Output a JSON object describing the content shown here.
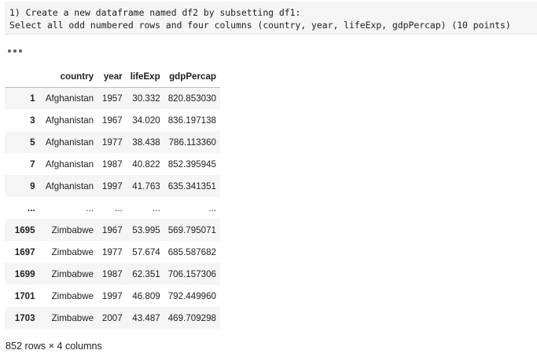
{
  "code_cell": {
    "line1": "1) Create a new dataframe named df2 by subsetting df1:",
    "line2": "Select all odd numbered rows and four columns (country, year, lifeExp, gdpPercap) (10 points)"
  },
  "output": {
    "columns": [
      "",
      "country",
      "year",
      "lifeExp",
      "gdpPercap"
    ],
    "rows": [
      {
        "index": "1",
        "country": "Afghanistan",
        "year": "1957",
        "lifeExp": "30.332",
        "gdpPercap": "820.853030"
      },
      {
        "index": "3",
        "country": "Afghanistan",
        "year": "1967",
        "lifeExp": "34.020",
        "gdpPercap": "836.197138"
      },
      {
        "index": "5",
        "country": "Afghanistan",
        "year": "1977",
        "lifeExp": "38.438",
        "gdpPercap": "786.113360"
      },
      {
        "index": "7",
        "country": "Afghanistan",
        "year": "1987",
        "lifeExp": "40.822",
        "gdpPercap": "852.395945"
      },
      {
        "index": "9",
        "country": "Afghanistan",
        "year": "1997",
        "lifeExp": "41.763",
        "gdpPercap": "635.341351"
      },
      {
        "index": "...",
        "country": "...",
        "year": "...",
        "lifeExp": "...",
        "gdpPercap": "..."
      },
      {
        "index": "1695",
        "country": "Zimbabwe",
        "year": "1967",
        "lifeExp": "53.995",
        "gdpPercap": "569.795071"
      },
      {
        "index": "1697",
        "country": "Zimbabwe",
        "year": "1977",
        "lifeExp": "57.674",
        "gdpPercap": "685.587682"
      },
      {
        "index": "1699",
        "country": "Zimbabwe",
        "year": "1987",
        "lifeExp": "62.351",
        "gdpPercap": "706.157306"
      },
      {
        "index": "1701",
        "country": "Zimbabwe",
        "year": "1997",
        "lifeExp": "46.809",
        "gdpPercap": "792.449960"
      },
      {
        "index": "1703",
        "country": "Zimbabwe",
        "year": "2007",
        "lifeExp": "43.487",
        "gdpPercap": "469.709298"
      }
    ],
    "shape": "852 rows × 4 columns"
  },
  "icons": {
    "more": "ellipsis-icon"
  },
  "colors": {
    "code_background": "#f5f5f5",
    "striped_row": "#f5f5f5",
    "text": "#212121"
  }
}
